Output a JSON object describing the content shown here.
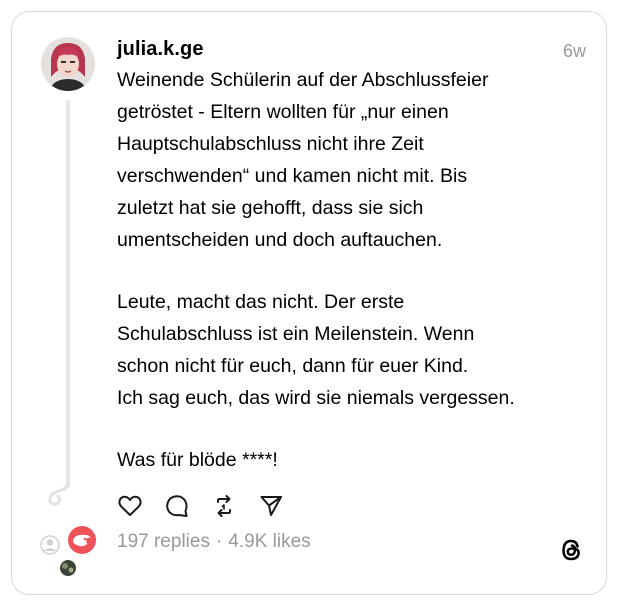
{
  "post": {
    "username": "julia.k.ge",
    "timestamp": "6w",
    "paragraph1": [
      "Weinende Schülerin auf der Abschlussfeier",
      "getröstet - Eltern wollten für „nur einen",
      "Hauptschulabschluss nicht ihre Zeit",
      "verschwenden“ und kamen nicht mit. Bis",
      "zuletzt hat sie gehofft, dass sie sich",
      "umentscheiden und doch auftauchen."
    ],
    "paragraph2": [
      "Leute, macht das nicht. Der erste",
      "Schulabschluss ist ein Meilenstein. Wenn",
      "schon nicht für euch, dann für euer Kind.",
      "Ich sag euch, das wird sie niemals vergessen."
    ],
    "paragraph3": [
      "Was für blöde ****!"
    ],
    "replies": "197 replies",
    "separator": "·",
    "likes": "4.9K likes"
  },
  "icons": {
    "like": "heart-icon",
    "reply": "comment-icon",
    "repost": "repost-icon",
    "share": "send-icon",
    "brand": "threads-logo-icon"
  },
  "colors": {
    "text": "#000000",
    "muted": "#999999",
    "border": "#d9d9d9",
    "thread_line": "#e7e7e7",
    "reply_avatar_accent": "#f0525a"
  }
}
